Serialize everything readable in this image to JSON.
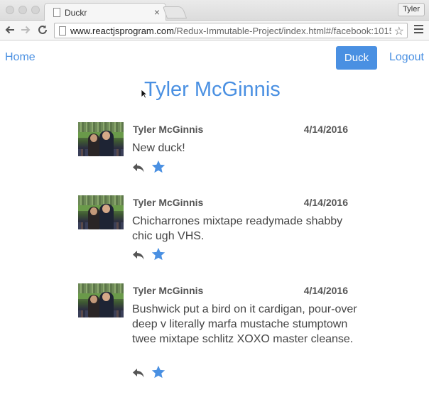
{
  "browser": {
    "tab_title": "Duckr",
    "tab_close": "×",
    "profile_name": "Tyler",
    "url_host": "www.reactjsprogram.com",
    "url_path": "/Redux-Immutable-Project/index.html#/facebook:1015..."
  },
  "nav": {
    "home_label": "Home",
    "duck_label": "Duck",
    "logout_label": "Logout"
  },
  "profile": {
    "name": "Tyler McGinnis"
  },
  "ducks": [
    {
      "author": "Tyler McGinnis",
      "date": "4/14/2016",
      "text": "New duck!"
    },
    {
      "author": "Tyler McGinnis",
      "date": "4/14/2016",
      "text": "Chicharrones mixtape readymade shabby chic ugh VHS."
    },
    {
      "author": "Tyler McGinnis",
      "date": "4/14/2016",
      "text": "Bushwick put a bird on it cardigan, pour-over deep v literally marfa mustache stumptown twee mixtape schlitz XOXO master cleanse."
    }
  ],
  "colors": {
    "accent": "#4a90e2",
    "text": "#444444",
    "icon": "#555555"
  },
  "icons": {
    "reply": "reply-icon",
    "like": "star-icon"
  }
}
